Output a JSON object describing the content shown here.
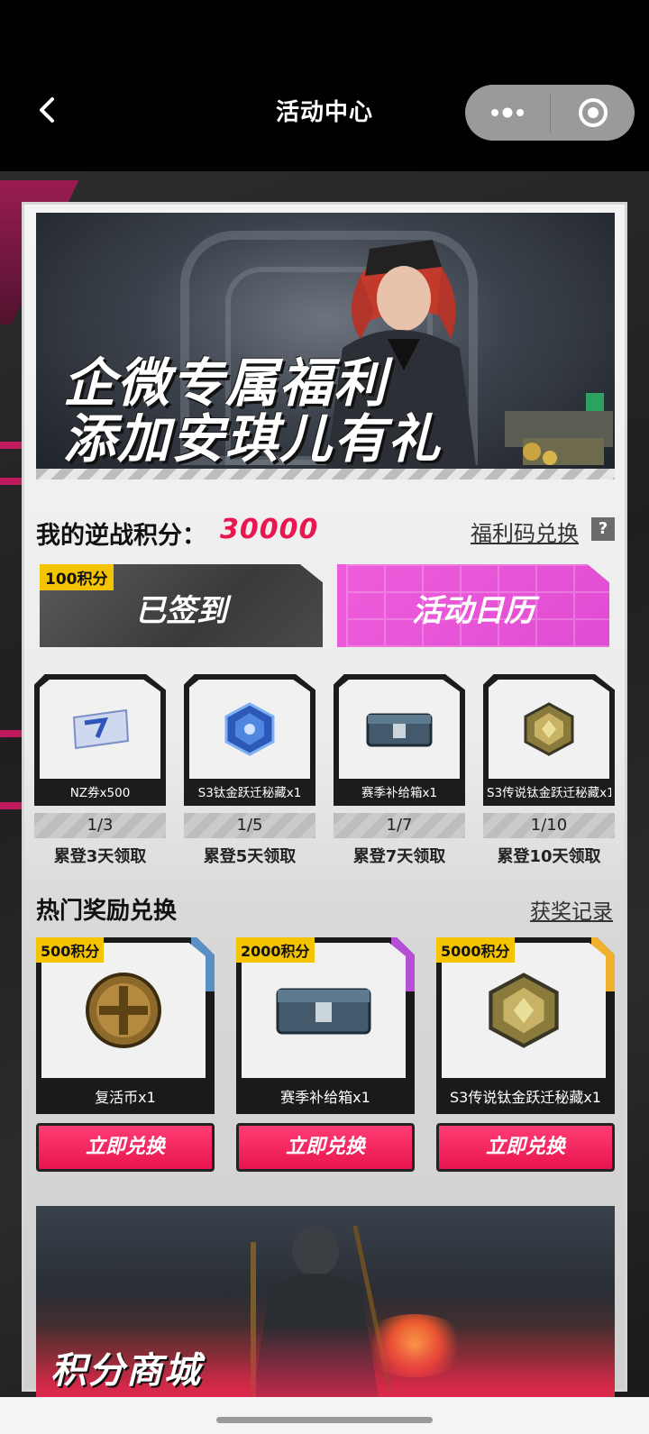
{
  "nav": {
    "title": "活动中心"
  },
  "banner": {
    "line1": "企微专属福利",
    "line2": "添加安琪儿有礼"
  },
  "points": {
    "label": "我的逆战积分：",
    "value": "30000",
    "redeem_link": "福利码兑换",
    "help": "?"
  },
  "signin": {
    "tag": "100积分",
    "label": "已签到"
  },
  "calendar": {
    "label": "活动日历"
  },
  "login_rewards": [
    {
      "name": "NZ券x500",
      "progress": "1/3",
      "condition": "累登3天领取",
      "icon": "ticket-icon"
    },
    {
      "name": "S3钛金跃迁秘藏x1",
      "progress": "1/5",
      "condition": "累登5天领取",
      "icon": "crystal-icon"
    },
    {
      "name": "赛季补给箱x1",
      "progress": "1/7",
      "condition": "累登7天领取",
      "icon": "supply-box-icon"
    },
    {
      "name": "S3传说钛金跃迁秘藏x1",
      "progress": "1/10",
      "condition": "累登10天领取",
      "icon": "legend-crystal-icon"
    }
  ],
  "exchange": {
    "title": "热门奖励兑换",
    "record_link": "获奖记录",
    "items": [
      {
        "tag": "500积分",
        "name": "复活币x1",
        "button": "立即兑换",
        "accent": "#5a8fc4",
        "icon": "revive-coin-icon"
      },
      {
        "tag": "2000积分",
        "name": "赛季补给箱x1",
        "button": "立即兑换",
        "accent": "#b44fd6",
        "icon": "supply-box-icon"
      },
      {
        "tag": "5000积分",
        "name": "S3传说钛金跃迁秘藏x1",
        "button": "立即兑换",
        "accent": "#f0b12c",
        "icon": "legend-crystal-icon"
      }
    ]
  },
  "mall": {
    "title": "积分商城"
  },
  "colors": {
    "accent_pink": "#e8174f",
    "calendar_magenta": "#e04cd2",
    "tag_yellow": "#f5c400"
  }
}
